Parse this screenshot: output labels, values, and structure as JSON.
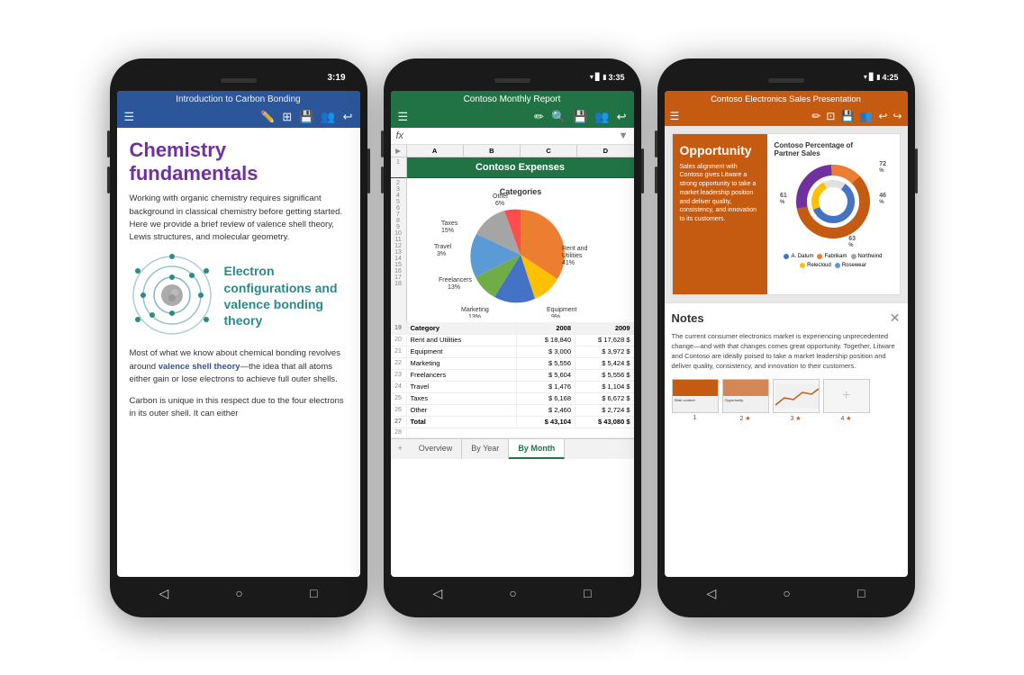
{
  "phones": {
    "phone1": {
      "time": "3:19",
      "app": "word",
      "title": "Introduction to Carbon Bonding",
      "heading1": "Chemistry fundamentals",
      "body1": "Working with organic chemistry requires significant background in classical chemistry before getting started. Here we provide a brief review of valence shell theory, Lewis structures, and molecular geometry.",
      "heading2": "Electron configurations and valence bonding theory",
      "body2a": "Most of what we know about chemical bonding revolves around ",
      "body2link": "valence shell theory",
      "body2b": "—the idea that all atoms either gain or lose electrons to achieve full outer shells.",
      "body3": "Carbon is unique in this respect due to the four electrons in its outer shell. It can either"
    },
    "phone2": {
      "time": "3:35",
      "app": "excel",
      "title": "Contoso Monthly Report",
      "section": "Contoso Expenses",
      "formula_label": "fx",
      "chart_categories_label": "Categories",
      "chart_labels": [
        "Rent and Utilities 41%",
        "Equipment 9%",
        "Marketing 13%",
        "Freelancers 13%",
        "Travel 3%",
        "Taxes 15%",
        "Other 6%"
      ],
      "table_header": [
        "Category",
        "2008",
        "2009"
      ],
      "table_rows": [
        [
          "Rent and Utilities",
          "$ 18,840",
          "$ 17,628 $"
        ],
        [
          "Equipment",
          "$ 3,000",
          "$ 3,972 $"
        ],
        [
          "Marketing",
          "$ 5,556",
          "$ 5,424 $"
        ],
        [
          "Freelancers",
          "$ 5,604",
          "$ 5,556 $"
        ],
        [
          "Travel",
          "$ 1,476",
          "$ 1,104 $"
        ],
        [
          "Taxes",
          "$ 6,168",
          "$ 6,672 $"
        ],
        [
          "Other",
          "$ 2,460",
          "$ 2,724 $"
        ],
        [
          "Total",
          "$ 43,104",
          "$ 43,080 $"
        ]
      ],
      "row_numbers": [
        19,
        20,
        21,
        22,
        23,
        24,
        25,
        26,
        27,
        28
      ],
      "tabs": [
        "Overview",
        "By Year",
        "By Month"
      ]
    },
    "phone3": {
      "time": "4:25",
      "app": "powerpoint",
      "title": "Contoso Electronics Sales Presentation",
      "slide_title": "Opportunity",
      "slide_text": "Sales alignment with Contoso gives Litware a strong opportunity to take a market leadership position and deliver quality, consistency, and innovation to its customers.",
      "chart_title": "Contoso Percentage of Partner Sales",
      "percentages": [
        "72",
        "61",
        "46",
        "63"
      ],
      "legend_items": [
        "A. Datum",
        "Fabrikam",
        "Northwind",
        "Relecloud",
        "Rosewear"
      ],
      "legend_colors": [
        "#4472c4",
        "#ed7d31",
        "#a5a5a5",
        "#ffc000",
        "#5b9bd5"
      ],
      "notes_title": "Notes",
      "notes_text": "The current consumer electronics market is experiencing unprecedented change—and with that changes comes great opportunity. Together, Litware and Contoso are ideally poised to take a market leadership position and deliver quality, consistency, and innovation to their customers.",
      "slide_numbers": [
        "1",
        "2 ★",
        "3 ★",
        "4 ★"
      ]
    }
  }
}
